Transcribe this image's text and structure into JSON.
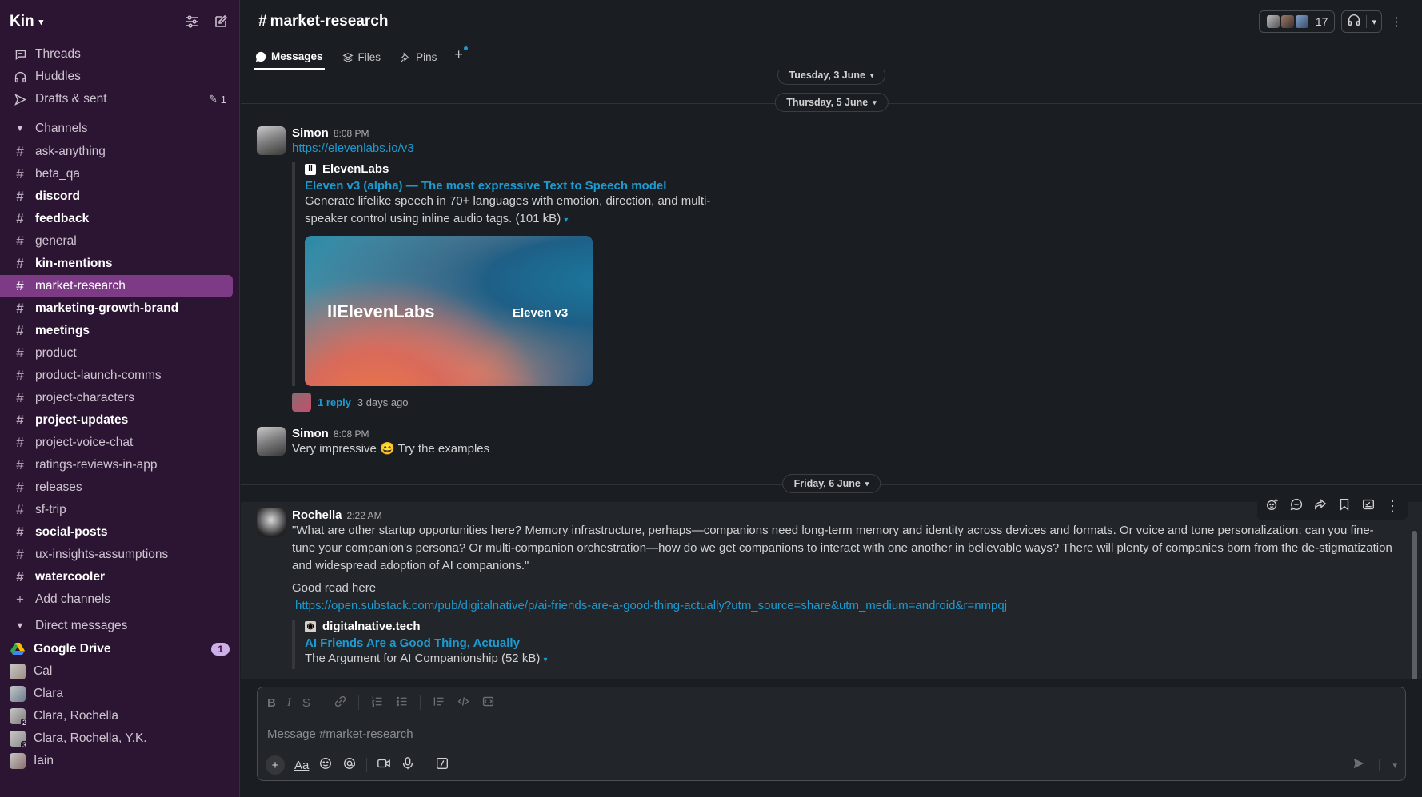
{
  "workspace": {
    "name": "Kin"
  },
  "nav": [
    {
      "label": "Threads",
      "icon": "threads-icon"
    },
    {
      "label": "Huddles",
      "icon": "headphones-icon"
    },
    {
      "label": "Drafts & sent",
      "icon": "send-icon",
      "count": "1"
    }
  ],
  "channels_header": "Channels",
  "channels": [
    {
      "name": "ask-anything",
      "bold": false
    },
    {
      "name": "beta_qa",
      "bold": false
    },
    {
      "name": "discord",
      "bold": true
    },
    {
      "name": "feedback",
      "bold": true
    },
    {
      "name": "general",
      "bold": false
    },
    {
      "name": "kin-mentions",
      "bold": true
    },
    {
      "name": "market-research",
      "bold": false,
      "active": true
    },
    {
      "name": "marketing-growth-brand",
      "bold": true
    },
    {
      "name": "meetings",
      "bold": true
    },
    {
      "name": "product",
      "bold": false
    },
    {
      "name": "product-launch-comms",
      "bold": false
    },
    {
      "name": "project-characters",
      "bold": false
    },
    {
      "name": "project-updates",
      "bold": true
    },
    {
      "name": "project-voice-chat",
      "bold": false
    },
    {
      "name": "ratings-reviews-in-app",
      "bold": false
    },
    {
      "name": "releases",
      "bold": false
    },
    {
      "name": "sf-trip",
      "bold": false
    },
    {
      "name": "social-posts",
      "bold": true
    },
    {
      "name": "ux-insights-assumptions",
      "bold": false
    },
    {
      "name": "watercooler",
      "bold": true
    }
  ],
  "add_channels": "Add channels",
  "dm_header": "Direct messages",
  "dms": [
    {
      "name": "Google Drive",
      "bold": true,
      "badge": "1"
    },
    {
      "name": "Cal",
      "bold": false
    },
    {
      "name": "Clara",
      "bold": false
    },
    {
      "name": "Clara, Rochella",
      "bold": false,
      "group": "2"
    },
    {
      "name": "Clara, Rochella, Y.K.",
      "bold": false,
      "group": "3"
    },
    {
      "name": "Iain",
      "bold": false
    }
  ],
  "header": {
    "hash": "#",
    "title": "market-research",
    "member_count": "17"
  },
  "tabs": [
    {
      "label": "Messages",
      "active": true
    },
    {
      "label": "Files",
      "active": false
    },
    {
      "label": "Pins",
      "active": false
    }
  ],
  "dates": {
    "d1": "Tuesday, 3 June",
    "d2": "Thursday, 5 June",
    "d3": "Friday, 6 June"
  },
  "messages": {
    "m1": {
      "author": "Simon",
      "time": "8:08 PM",
      "link": "https://elevenlabs.io/v3",
      "unfurl": {
        "site": "ElevenLabs",
        "title": "Eleven v3 (alpha) — The most expressive Text to Speech model",
        "desc": "Generate lifelike speech in 70+ languages with emotion, direction, and multi-speaker control using inline audio tags. (101 kB)",
        "preview_brand": "IIElevenLabs",
        "preview_tag": "Eleven v3"
      },
      "reply": "1 reply",
      "reply_ago": "3 days ago"
    },
    "m2": {
      "author": "Simon",
      "time": "8:08 PM",
      "text_a": "Very impressive",
      "emoji": "😄",
      "text_b": "Try the examples"
    },
    "m3": {
      "author": "Rochella",
      "time": "2:22 AM",
      "quote": "\"What are other startup opportunities here? Memory infrastructure, perhaps—companions need long-term memory and identity across devices and formats. Or voice and tone personalization: can you fine-tune your companion's persona? Or multi-companion orchestration—how do we get companions to interact with one another in believable ways? There will plenty of companies born from the de-stigmatization and widespread adoption of AI companions.\"",
      "text": "Good read here",
      "link": "https://open.substack.com/pub/digitalnative/p/ai-friends-are-a-good-thing-actually?utm_source=share&utm_medium=android&r=nmpqj",
      "unfurl": {
        "site": "digitalnative.tech",
        "title": "AI Friends Are a Good Thing, Actually",
        "desc": "The Argument for AI Companionship (52 kB)"
      }
    }
  },
  "composer": {
    "placeholder": "Message #market-research"
  },
  "colors": {
    "sidebar": "#2b1533",
    "active_channel": "#7d3b86",
    "link": "#1d9bd1",
    "background": "#1a1d21"
  }
}
